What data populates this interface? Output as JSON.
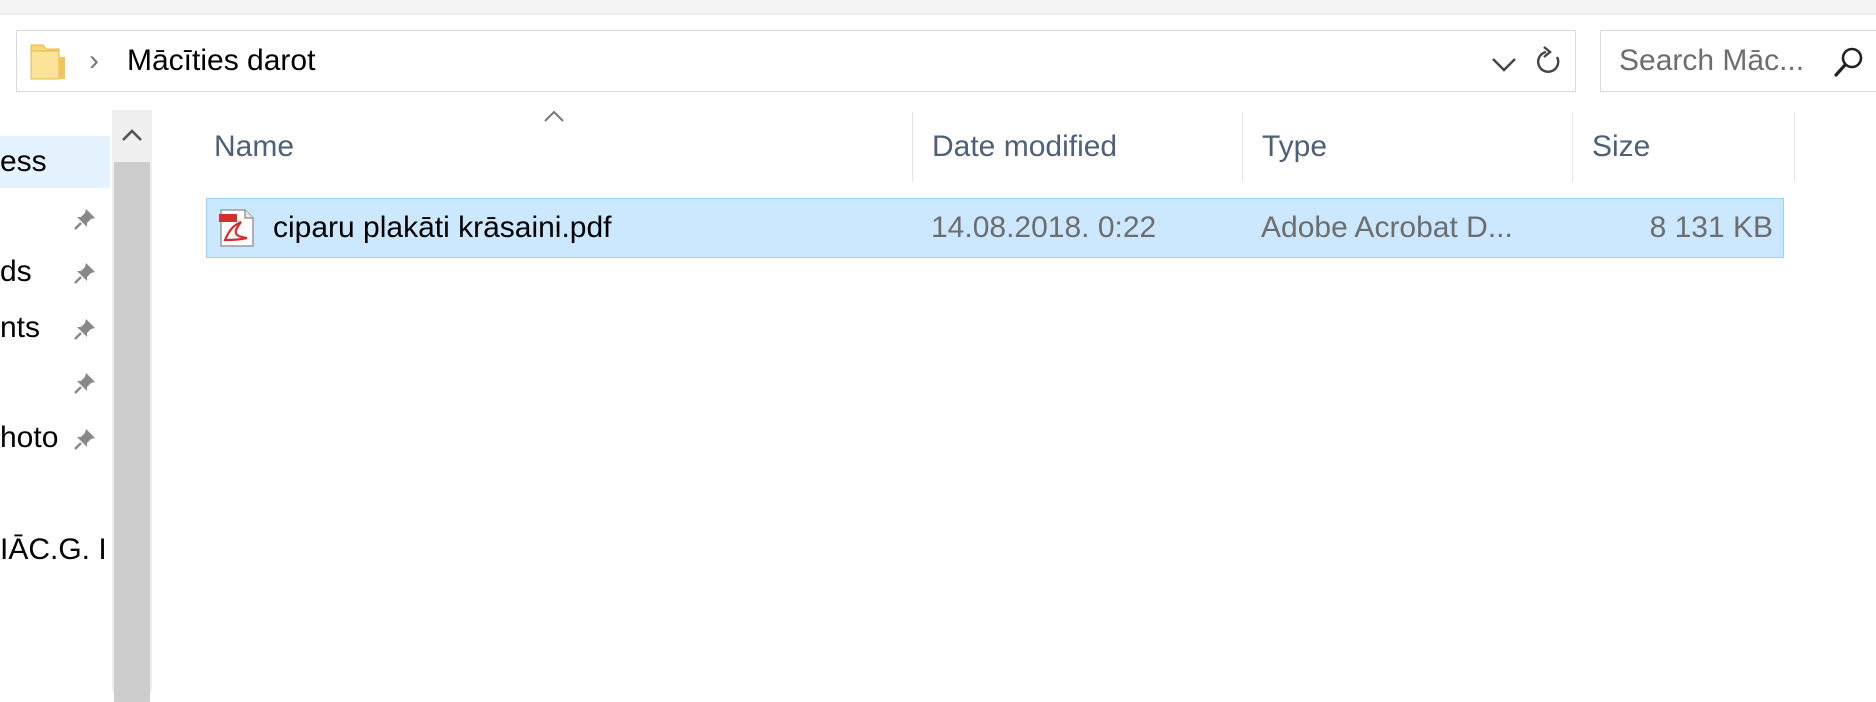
{
  "address_bar": {
    "separator": "›",
    "path": "Mācīties darot"
  },
  "search": {
    "placeholder": "Search Māc..."
  },
  "nav_pane": {
    "items": [
      {
        "label": "ess",
        "pinned": false,
        "selected": true
      },
      {
        "label": "",
        "pinned": true,
        "selected": false
      },
      {
        "label": "ds",
        "pinned": true,
        "selected": false
      },
      {
        "label": "nts",
        "pinned": true,
        "selected": false
      },
      {
        "label": "",
        "pinned": true,
        "selected": false
      },
      {
        "label": "hoto",
        "pinned": true,
        "selected": false
      },
      {
        "label": "",
        "pinned": false,
        "selected": false
      },
      {
        "label": "IĀC.G. I",
        "pinned": false,
        "selected": false
      }
    ]
  },
  "file_list": {
    "columns": [
      {
        "key": "name",
        "label": "Name"
      },
      {
        "key": "date",
        "label": "Date modified"
      },
      {
        "key": "type",
        "label": "Type"
      },
      {
        "key": "size",
        "label": "Size"
      }
    ],
    "sort_column": "name",
    "rows": [
      {
        "name": "ciparu plakāti krāsaini.pdf",
        "date": "14.08.2018. 0:22",
        "type": "Adobe Acrobat D...",
        "size": "8 131 KB",
        "icon": "pdf-file-icon",
        "selected": true
      }
    ]
  },
  "colors": {
    "selection_bg": "#cce8ff",
    "selection_border": "#99d1ff",
    "header_text": "#4c607a",
    "muted_text": "#6d6d6d",
    "folder_yellow": "#f8d775",
    "pdf_red": "#d32f2f"
  }
}
